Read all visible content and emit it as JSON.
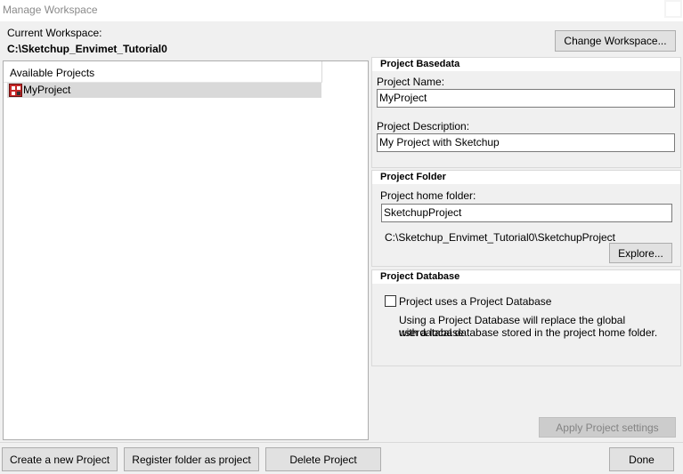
{
  "window": {
    "title": "Manage Workspace"
  },
  "workspace": {
    "label": "Current Workspace:",
    "path": "C:\\Sketchup_Envimet_Tutorial0",
    "change_button": "Change Workspace..."
  },
  "projects_list": {
    "header": "Available Projects",
    "items": [
      {
        "name": "MyProject",
        "selected": true
      }
    ]
  },
  "basedata": {
    "title": "Project Basedata",
    "name_label": "Project Name:",
    "name_value": "MyProject",
    "desc_label": "Project Description:",
    "desc_value": "My Project with Sketchup"
  },
  "folder": {
    "title": "Project Folder",
    "home_label": "Project home folder:",
    "home_value": "SketchupProject",
    "full_path": "C:\\Sketchup_Envimet_Tutorial0\\SketchupProject",
    "explore_button": "Explore..."
  },
  "database": {
    "title": "Project Database",
    "checkbox_label": "Project uses a Project Database",
    "checked": false,
    "info_line1": "Using a Project Database will replace the global userdatabase",
    "info_line2": "with a local database stored in the project home folder."
  },
  "buttons": {
    "apply": "Apply Project settings",
    "create": "Create a new Project",
    "register": "Register folder as project",
    "delete": "Delete Project",
    "done": "Done"
  }
}
